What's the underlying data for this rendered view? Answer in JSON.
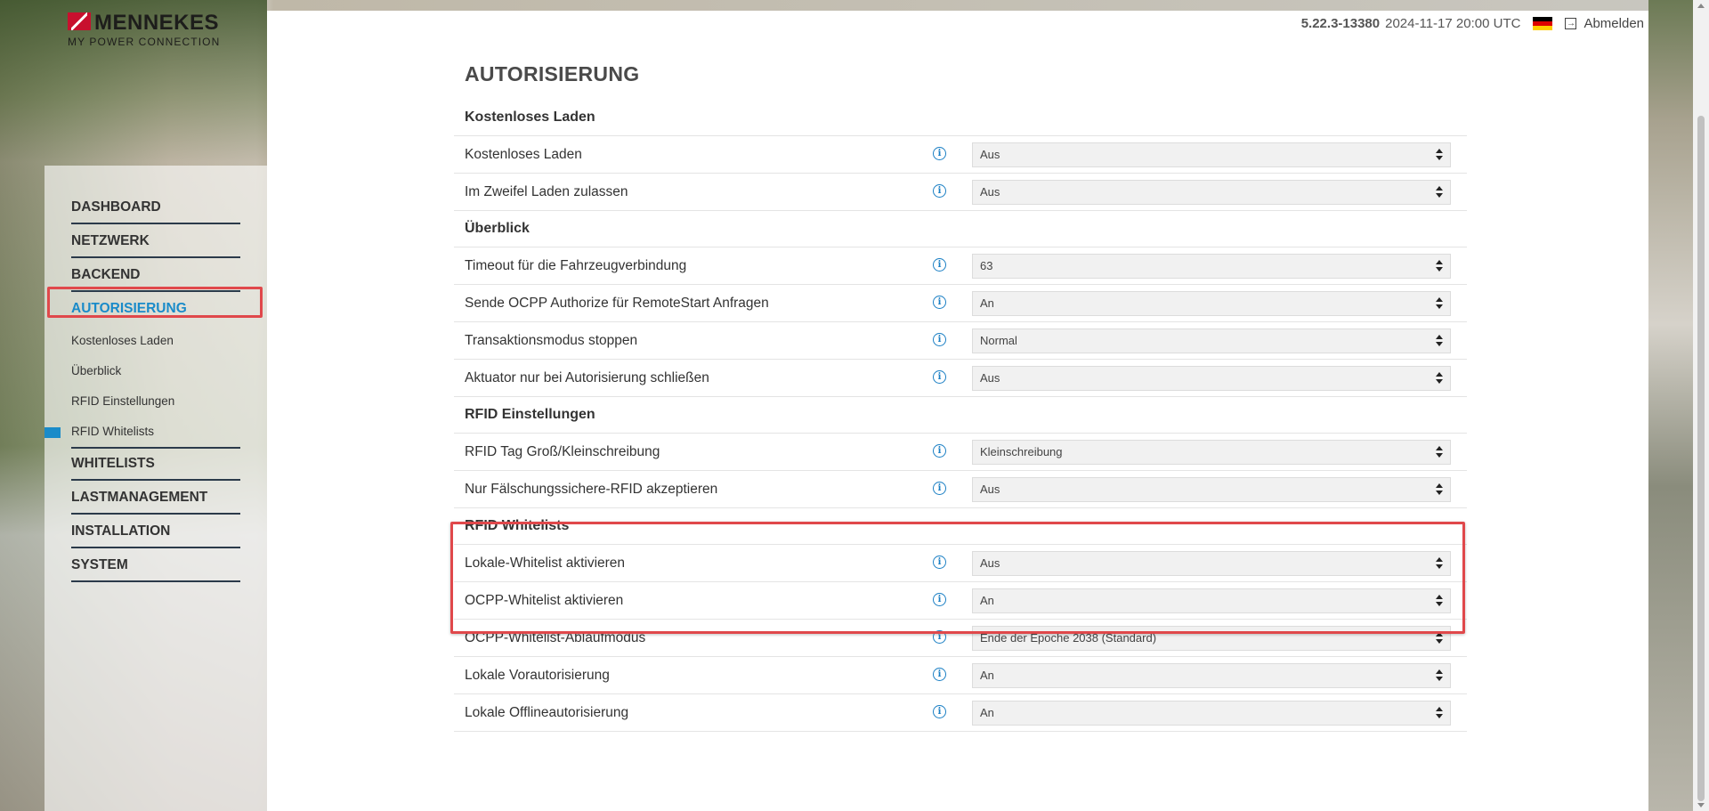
{
  "brand": {
    "name": "MENNEKES",
    "tagline": "MY POWER CONNECTION"
  },
  "topbar": {
    "version": "5.22.3-13380",
    "datetime": "2024-11-17 20:00 UTC",
    "language_flag": "german-flag-icon",
    "logout_label": "Abmelden"
  },
  "nav": {
    "items": [
      {
        "label": "DASHBOARD"
      },
      {
        "label": "NETZWERK"
      },
      {
        "label": "BACKEND"
      },
      {
        "label": "AUTORISIERUNG",
        "active": true
      },
      {
        "label": "WHITELISTS"
      },
      {
        "label": "LASTMANAGEMENT"
      },
      {
        "label": "INSTALLATION"
      },
      {
        "label": "SYSTEM"
      }
    ],
    "subitems": [
      {
        "label": "Kostenloses Laden"
      },
      {
        "label": "Überblick"
      },
      {
        "label": "RFID Einstellungen"
      },
      {
        "label": "RFID Whitelists",
        "current": true
      }
    ]
  },
  "page": {
    "title": "AUTORISIERUNG",
    "sections": [
      {
        "heading": "Kostenloses Laden",
        "rows": [
          {
            "label": "Kostenloses Laden",
            "value": "Aus"
          },
          {
            "label": "Im Zweifel Laden zulassen",
            "value": "Aus"
          }
        ]
      },
      {
        "heading": "Überblick",
        "rows": [
          {
            "label": "Timeout für die Fahrzeugverbindung",
            "value": "63"
          },
          {
            "label": "Sende OCPP Authorize für RemoteStart Anfragen",
            "value": "An"
          },
          {
            "label": "Transaktionsmodus stoppen",
            "value": "Normal"
          },
          {
            "label": "Aktuator nur bei Autorisierung schließen",
            "value": "Aus"
          }
        ]
      },
      {
        "heading": "RFID Einstellungen",
        "rows": [
          {
            "label": "RFID Tag Groß/Kleinschreibung",
            "value": "Kleinschreibung"
          },
          {
            "label": "Nur Fälschungssichere-RFID akzeptieren",
            "value": "Aus"
          }
        ]
      },
      {
        "heading": "RFID Whitelists",
        "rows": [
          {
            "label": "Lokale-Whitelist aktivieren",
            "value": "Aus"
          },
          {
            "label": "OCPP-Whitelist aktivieren",
            "value": "An"
          },
          {
            "label": "OCPP-Whitelist-Ablaufmodus",
            "value": "Ende der Epoche 2038 (Standard)"
          },
          {
            "label": "Lokale Vorautorisierung",
            "value": "An"
          },
          {
            "label": "Lokale Offlineautorisierung",
            "value": "An"
          }
        ]
      }
    ]
  },
  "colors": {
    "accent": "#1a8bc9",
    "highlight": "#e0484b",
    "brand_red": "#c8102e"
  }
}
